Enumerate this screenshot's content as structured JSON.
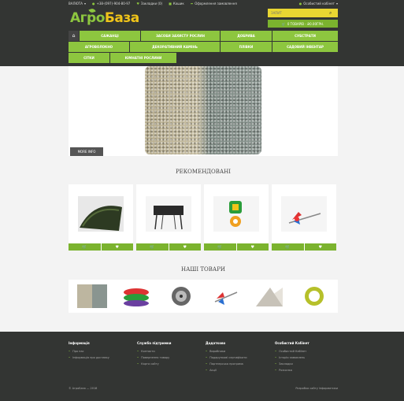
{
  "topbar": {
    "currency": "ВАЛЮТА",
    "phone": "+38-(097)-904-80-97",
    "items": [
      "Закладки (0)",
      "Кошик",
      "Оформлення замовлення",
      "Особистий кабінет"
    ]
  },
  "logo": {
    "part1": "Агро",
    "part2": "База",
    "tagline": ""
  },
  "search": {
    "placeholder": "ЗАПИТ"
  },
  "cart": {
    "label": "0 ТОВАРІВ - ₴0.00ГРН."
  },
  "nav": {
    "row1": [
      "САЖАНЦІ",
      "ЗАСОБИ ЗАХИСТУ РОСЛИН",
      "ДОБРИВА",
      "СУБСТРАТИ"
    ],
    "row2": [
      "АГРОВОЛОКНО",
      "ДЕКОРАТИВНИЙ КАМІНЬ",
      "ПЛІВКИ",
      "САДОВИЙ ІНВЕНТАР"
    ],
    "row3": [
      "СІТКИ",
      "КІМНАТНІ РОСЛИНИ"
    ]
  },
  "slider": {
    "more": "MORE INFO"
  },
  "featured_title": "РЕКОМЕНДОВАНІ",
  "products_title": "НАШІ ТОВАРИ",
  "footer": {
    "col1": {
      "title": "Інформація",
      "items": [
        "Про нас",
        "Інформація про доставку"
      ]
    },
    "col2": {
      "title": "Служба підтримки",
      "items": [
        "Контакти",
        "Повернення товару",
        "Карта сайту"
      ]
    },
    "col3": {
      "title": "Додатково",
      "items": [
        "Виробники",
        "Подарункові сертифікати",
        "Партнерська програма",
        "Акції"
      ]
    },
    "col4": {
      "title": "Особистий Кабінет",
      "items": [
        "Особистий Кабінет",
        "Історія замовлень",
        "Закладки",
        "Розсилка"
      ]
    },
    "copyright": "© АгроБаза — 2018",
    "credit": "Розробка сайту інформатики"
  },
  "colors": {
    "green": "#8dc63f",
    "dark": "#333533",
    "yellow": "#e8d632"
  }
}
